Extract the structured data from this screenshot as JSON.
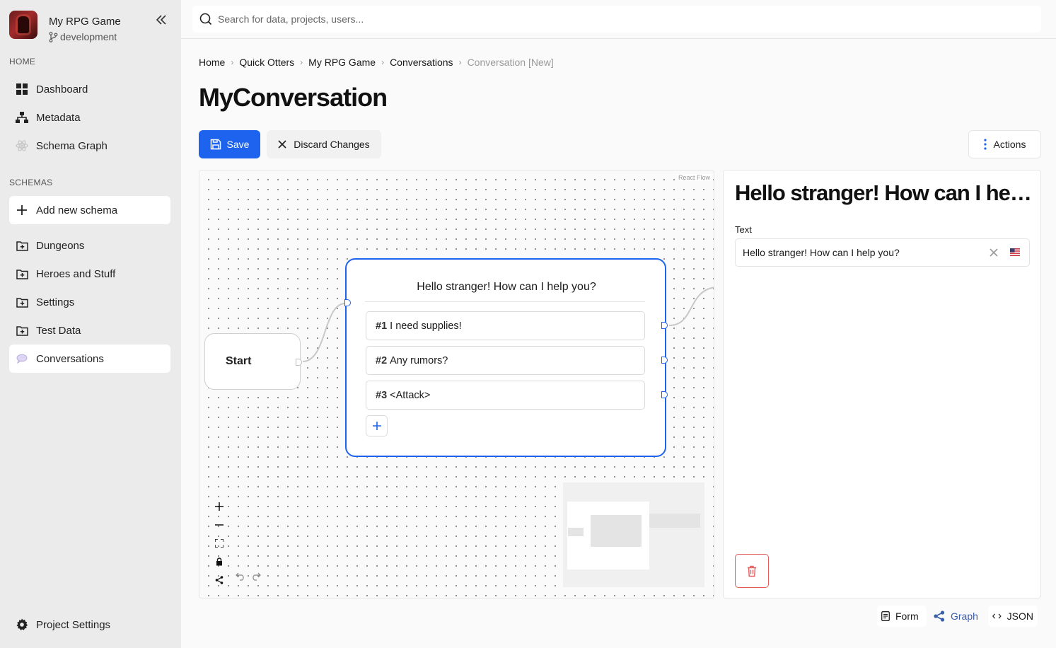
{
  "project": {
    "name": "My RPG Game",
    "branch": "development"
  },
  "sidebar": {
    "home_label": "HOME",
    "home_items": [
      {
        "label": "Dashboard",
        "icon": "dashboard-icon"
      },
      {
        "label": "Metadata",
        "icon": "sitemap-icon"
      },
      {
        "label": "Schema Graph",
        "icon": "atom-icon"
      }
    ],
    "schemas_label": "SCHEMAS",
    "add_schema": "Add new schema",
    "schemas": [
      {
        "label": "Dungeons",
        "icon": "folder-plus-icon"
      },
      {
        "label": "Heroes and Stuff",
        "icon": "folder-plus-icon"
      },
      {
        "label": "Settings",
        "icon": "folder-plus-icon"
      },
      {
        "label": "Test Data",
        "icon": "folder-plus-icon"
      },
      {
        "label": "Conversations",
        "icon": "chat-bubble-icon",
        "active": true
      }
    ],
    "footer": "Project Settings"
  },
  "search": {
    "placeholder": "Search for data, projects, users..."
  },
  "breadcrumb": [
    "Home",
    "Quick Otters",
    "My RPG Game",
    "Conversations",
    "Conversation [New]"
  ],
  "page_title": "MyConversation",
  "toolbar": {
    "save": "Save",
    "discard": "Discard Changes",
    "actions": "Actions"
  },
  "graph": {
    "attribution": "React Flow",
    "start_node": "Start",
    "node": {
      "title": "Hello stranger! How can I help you?",
      "choices": [
        {
          "num": "#1",
          "text": "I need supplies!"
        },
        {
          "num": "#2",
          "text": "Any rumors?"
        },
        {
          "num": "#3",
          "text": "<Attack>"
        }
      ]
    }
  },
  "detail": {
    "title": "Hello stranger! How can I help you?",
    "field_label": "Text",
    "field_value": "Hello stranger! How can I help you?"
  },
  "views": {
    "form": "Form",
    "graph": "Graph",
    "json": "JSON"
  },
  "colors": {
    "accent": "#1d63ed",
    "danger": "#e25b5b",
    "graph_tab": "#3a5ea8"
  }
}
